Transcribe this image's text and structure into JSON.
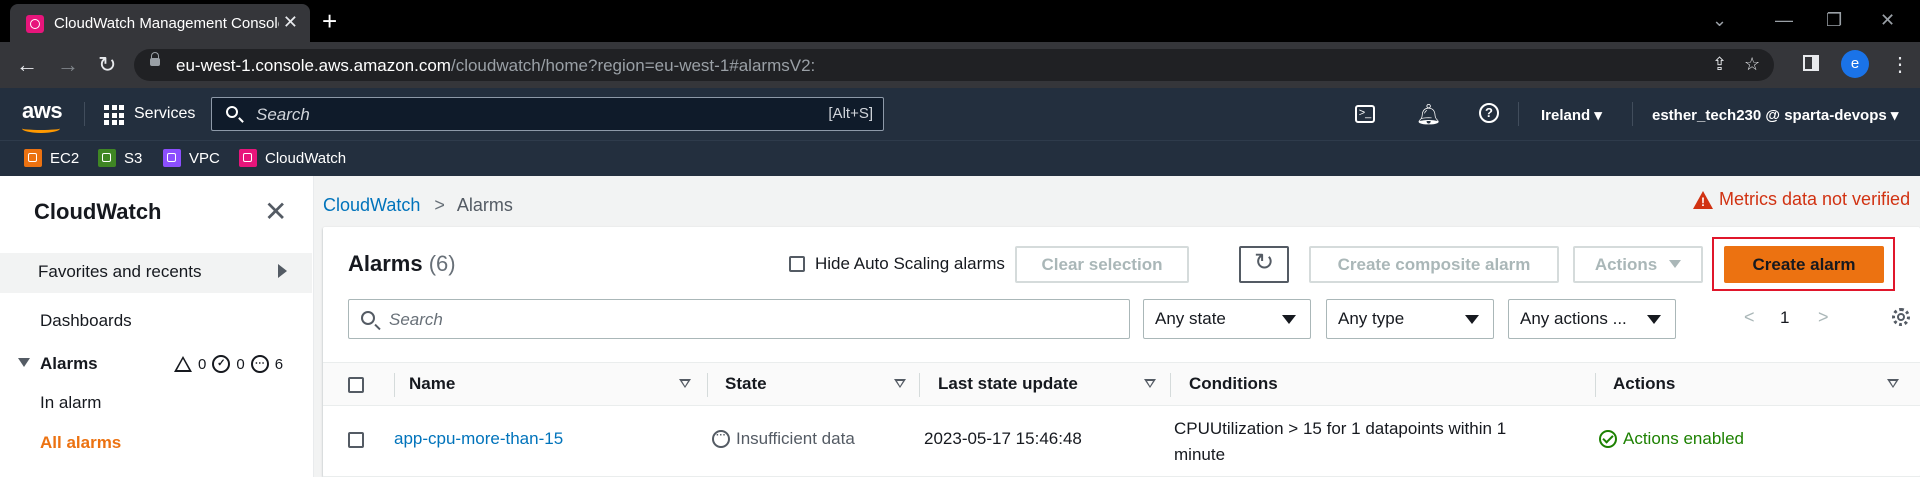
{
  "browser": {
    "tab_title": "CloudWatch Management Console",
    "close_glyph": "✕",
    "new_tab_glyph": "+",
    "url_host": "eu-west-1.console.aws.amazon.com",
    "url_path": "/cloudwatch/home?region=eu-west-1#alarmsV2:",
    "profile_initial": "e"
  },
  "aws_header": {
    "logo": "aws",
    "services_label": "Services",
    "search_placeholder": "Search",
    "search_shortcut": "[Alt+S]",
    "region": "Ireland",
    "account": "esther_tech230 @ sparta-devops"
  },
  "favorites_bar": [
    {
      "label": "EC2",
      "color": "#ec7211"
    },
    {
      "label": "S3",
      "color": "#3f8624"
    },
    {
      "label": "VPC",
      "color": "#8c4fff"
    },
    {
      "label": "CloudWatch",
      "color": "#e7157b"
    }
  ],
  "sidebar": {
    "title": "CloudWatch",
    "favorites_label": "Favorites and recents",
    "dashboards_label": "Dashboards",
    "alarms_label": "Alarms",
    "alarm_counts": {
      "alarm": "0",
      "ok": "0",
      "insufficient": "6"
    },
    "in_alarm_label": "In alarm",
    "all_alarms_label": "All alarms"
  },
  "breadcrumb": {
    "root": "CloudWatch",
    "current": "Alarms"
  },
  "metrics_warning": "Metrics data not verified",
  "alarms_panel": {
    "title": "Alarms",
    "count": "(6)",
    "hide_autoscaling_label": "Hide Auto Scaling alarms",
    "clear_selection": "Clear selection",
    "refresh_glyph": "↻",
    "create_composite": "Create composite alarm",
    "actions_label": "Actions",
    "create_alarm": "Create alarm",
    "search_placeholder": "Search",
    "state_filter": "Any state",
    "type_filter": "Any type",
    "actions_filter": "Any actions ...",
    "page": "1",
    "columns": {
      "name": "Name",
      "state": "State",
      "last_update": "Last state update",
      "conditions": "Conditions",
      "actions": "Actions"
    },
    "rows": [
      {
        "name": "app-cpu-more-than-15",
        "state": "Insufficient data",
        "last_update": "2023-05-17 15:46:48",
        "conditions_line1": "CPUUtilization > 15 for 1 datapoints within 1",
        "conditions_line2": "minute",
        "actions": "Actions enabled"
      }
    ]
  },
  "colors": {
    "accent": "#ec7211",
    "link": "#0073bb",
    "error": "#d13212",
    "success": "#1d8102",
    "nav_bg": "#232f3e"
  }
}
